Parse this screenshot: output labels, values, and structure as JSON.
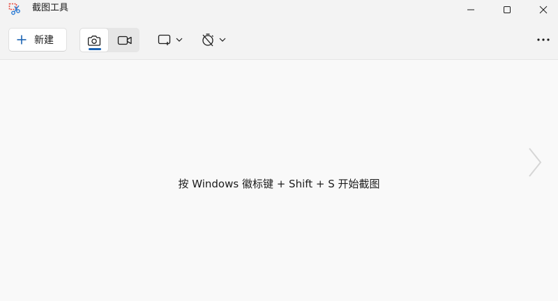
{
  "window": {
    "title": "截图工具"
  },
  "toolbar": {
    "new_label": "新建",
    "modes": [
      {
        "name": "photo",
        "icon": "camera-icon",
        "selected": true
      },
      {
        "name": "video",
        "icon": "video-camera-icon",
        "selected": false
      }
    ],
    "shape_icon": "rectangle-snip-icon",
    "delay_icon": "no-delay-timer-icon",
    "more_icon": "more-icon"
  },
  "main": {
    "hint": "按 Windows 徽标键 + Shift + S 开始截图"
  },
  "colors": {
    "accent": "#1a62b3",
    "app_icon_red": "#e8473c",
    "app_icon_blue": "#2a7bd4"
  }
}
